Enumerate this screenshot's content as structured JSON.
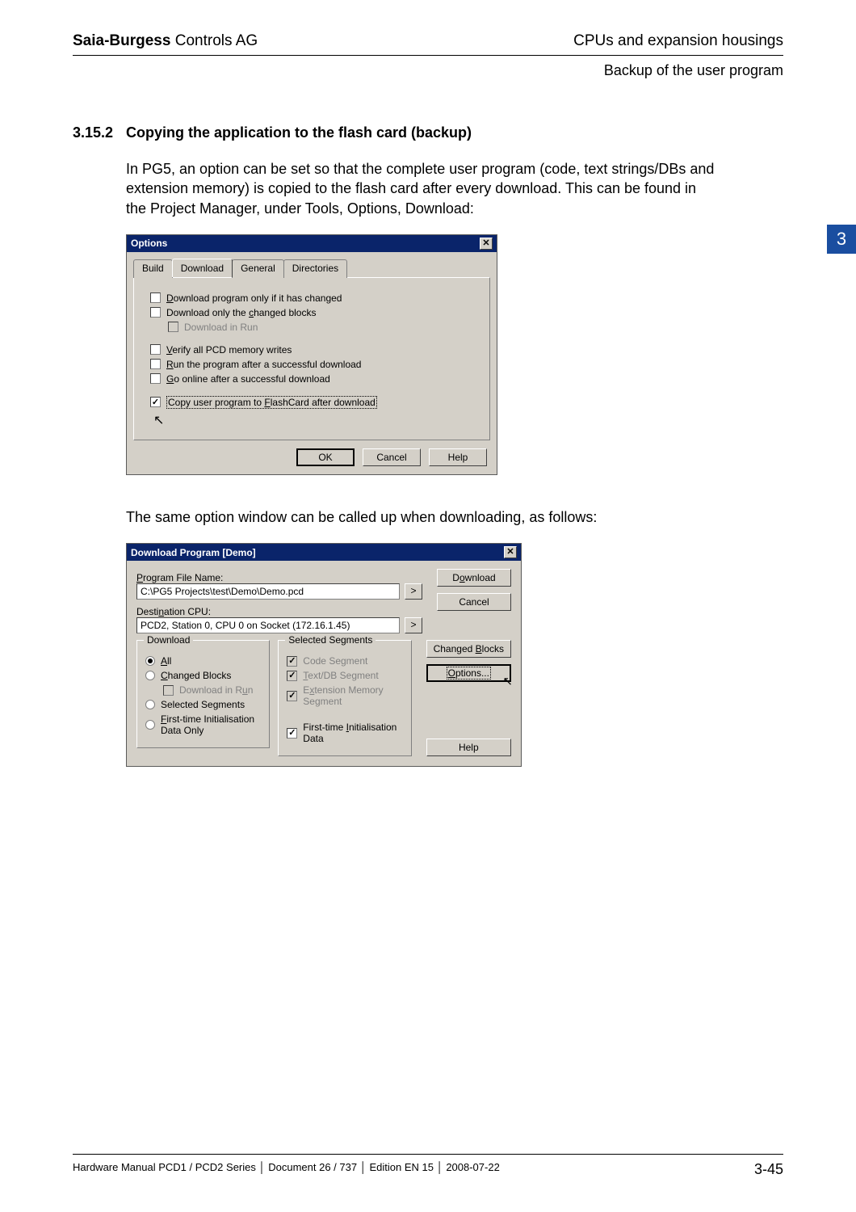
{
  "header": {
    "company_bold": "Saia-Burgess",
    "company_rest": " Controls AG",
    "right": "CPUs and expansion housings",
    "sub": "Backup of the user program"
  },
  "chapter_tab": "3",
  "section": {
    "number": "3.15.2",
    "title": "Copying the application to the flash card (backup)"
  },
  "para1": "In PG5, an option can be set so that the complete user program  (code, text strings/DBs and extension memory) is copied to the flash card after every download. This can be found in the Project Manager, under Tools, Options, Download:",
  "options_dialog": {
    "title": "Options",
    "tabs": {
      "build": "Build",
      "download": "Download",
      "general": "General",
      "directories": "Directories"
    },
    "cb": {
      "only_changed": "Download program only if it has changed",
      "only_blocks": "Download only the changed blocks",
      "in_run": "Download in Run",
      "verify": "Verify all PCD memory writes",
      "run_after": "Run the program after a successful download",
      "go_online": "Go online after a successful download",
      "copy_flash": "Copy user program to FlashCard after download"
    },
    "buttons": {
      "ok": "OK",
      "cancel": "Cancel",
      "help": "Help"
    }
  },
  "para2": "The same option window can be called up when downloading, as follows:",
  "download_dialog": {
    "title": "Download Program [Demo]",
    "program_label": "Program File Name:",
    "program_value": "C:\\PG5 Projects\\test\\Demo\\Demo.pcd",
    "dest_label": "Destination CPU:",
    "dest_value": "PCD2, Station 0, CPU 0 on Socket (172.16.1.45)",
    "browse": ">",
    "buttons": {
      "download": "Download",
      "cancel": "Cancel",
      "changed": "Changed Blocks",
      "options": "Options...",
      "help": "Help"
    },
    "group_download": {
      "legend": "Download",
      "all": "All",
      "changed": "Changed Blocks",
      "in_run": "Download in Run",
      "selected": "Selected Segments",
      "first_time": "First-time Initialisation Data Only"
    },
    "group_segments": {
      "legend": "Selected Segments",
      "code": "Code Segment",
      "text": "Text/DB Segment",
      "ext": "Extension Memory Segment",
      "first_time": "First-time Initialisation Data"
    }
  },
  "footer": {
    "a": "Hardware Manual PCD1 / PCD2 Series",
    "b": "Document 26 / 737",
    "c": "Edition EN 15",
    "d": "2008-07-22",
    "page": "3-45"
  }
}
